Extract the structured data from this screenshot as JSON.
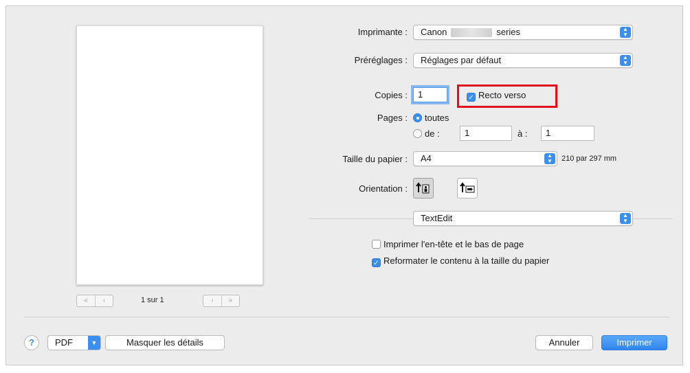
{
  "printer": {
    "label": "Imprimante :",
    "value_prefix": "Canon",
    "value_suffix": "series"
  },
  "presets": {
    "label": "Préréglages :",
    "value": "Réglages par défaut"
  },
  "copies": {
    "label": "Copies :",
    "value": "1"
  },
  "duplex": {
    "label": "Recto verso",
    "checked": true,
    "highlight_color": "#e0101a"
  },
  "pages": {
    "label": "Pages :",
    "all_label": "toutes",
    "range_label": "de :",
    "from_value": "1",
    "to_label": "à :",
    "to_value": "1"
  },
  "paper_size": {
    "label": "Taille du papier :",
    "value": "A4",
    "dimensions": "210 par 297 mm"
  },
  "orientation": {
    "label": "Orientation :",
    "selected": "portrait"
  },
  "app_section": {
    "value": "TextEdit"
  },
  "options": [
    {
      "label": "Imprimer l'en-tête et le bas de page",
      "checked": false
    },
    {
      "label": "Reformater le contenu à la taille du papier",
      "checked": true
    }
  ],
  "preview": {
    "page_indicator": "1 sur 1"
  },
  "footer": {
    "help": "?",
    "pdf": "PDF",
    "hide_details": "Masquer les détails",
    "cancel": "Annuler",
    "print": "Imprimer"
  },
  "colors": {
    "accent": "#3b8ff0",
    "dialog_bg": "#ececec"
  }
}
